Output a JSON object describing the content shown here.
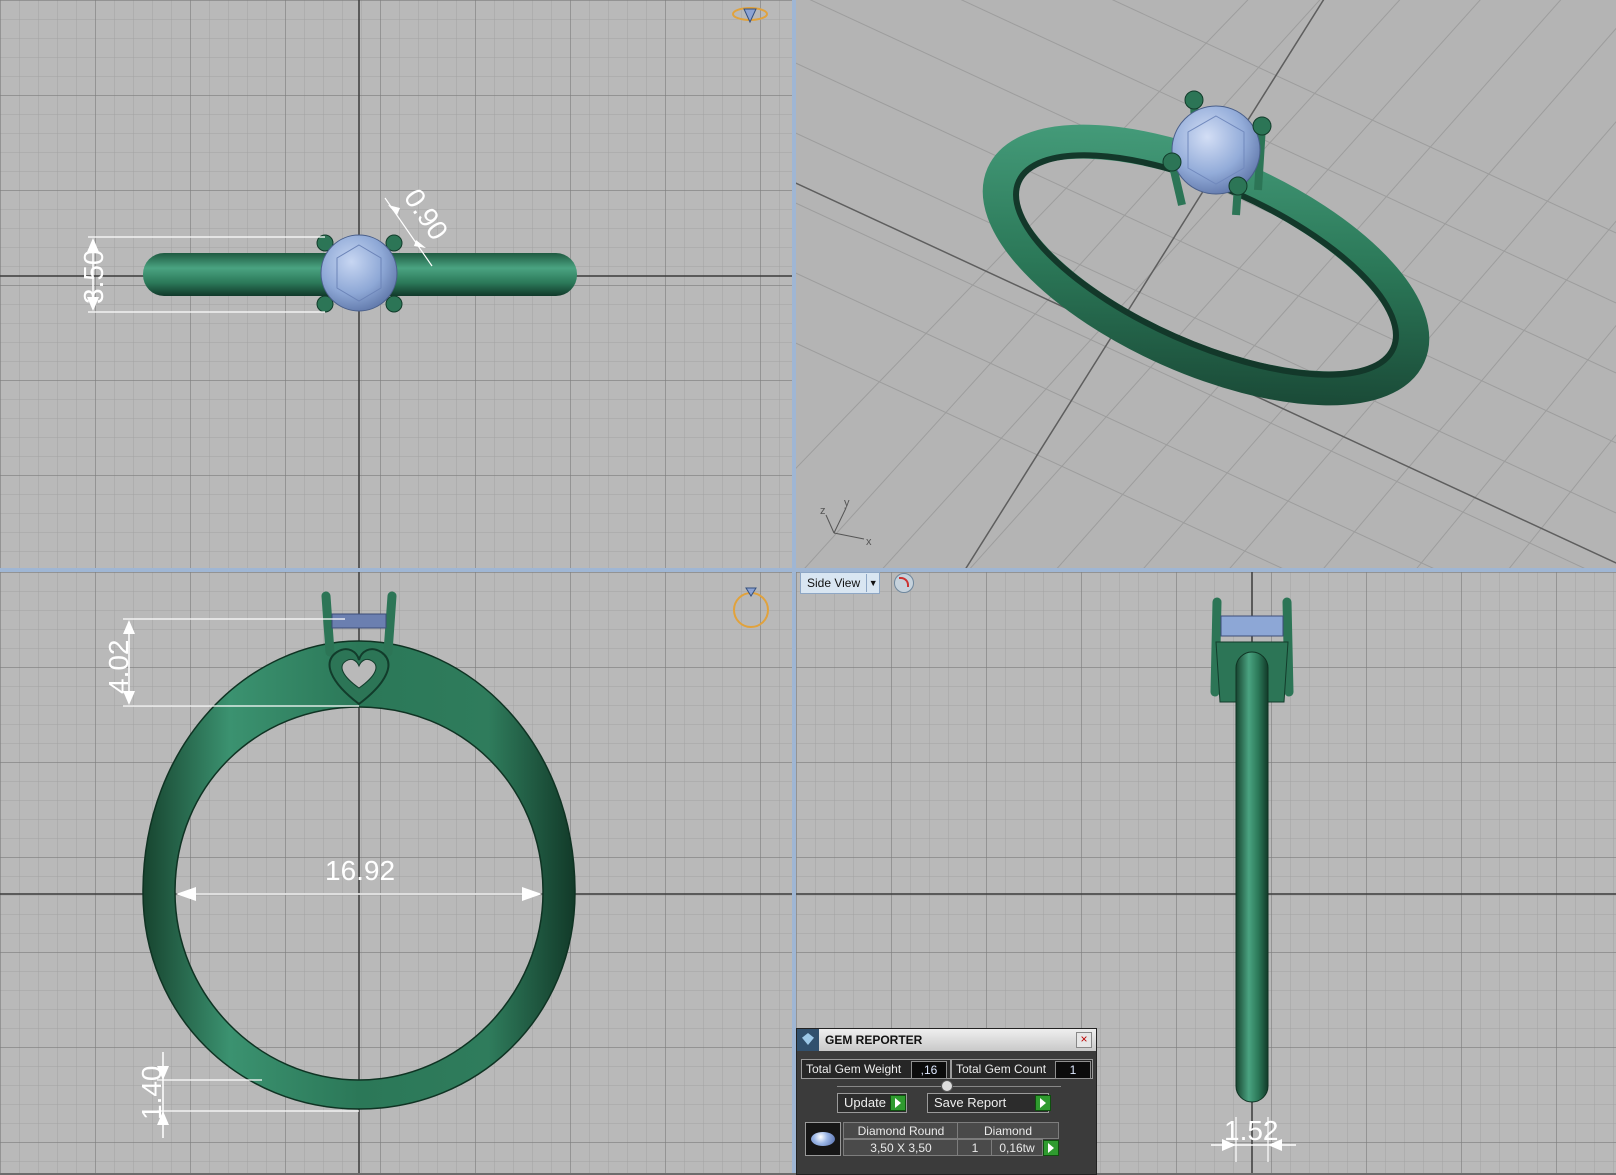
{
  "viewports": {
    "top": {
      "dimensions": {
        "height": "3.50",
        "prong": "0.90"
      }
    },
    "front": {
      "dimensions": {
        "head_height": "4.02",
        "inner_diameter": "16.92",
        "shank_thickness": "1.40"
      }
    },
    "side": {
      "label": "Side View",
      "dimensions": {
        "shank_width": "1.52"
      }
    },
    "perspective": {
      "axis_y": "y",
      "axis_x": "x",
      "axis_z": "z"
    }
  },
  "gem_reporter": {
    "title": "GEM REPORTER",
    "total_gem_weight_label": "Total Gem Weight",
    "total_gem_weight_value": ",16",
    "total_gem_count_label": "Total Gem Count",
    "total_gem_count_value": "1",
    "update_label": "Update",
    "save_report_label": "Save Report",
    "rows": [
      {
        "name": "Diamond Round",
        "size": "3,50 X 3,50",
        "material": "Diamond",
        "count": "1",
        "weight": "0,16tw"
      }
    ]
  },
  "colors": {
    "metal": "#2f7a5a",
    "gem": "#8fa9d6",
    "grid": "#b9b9b9",
    "separator": "#9fb6d4"
  }
}
